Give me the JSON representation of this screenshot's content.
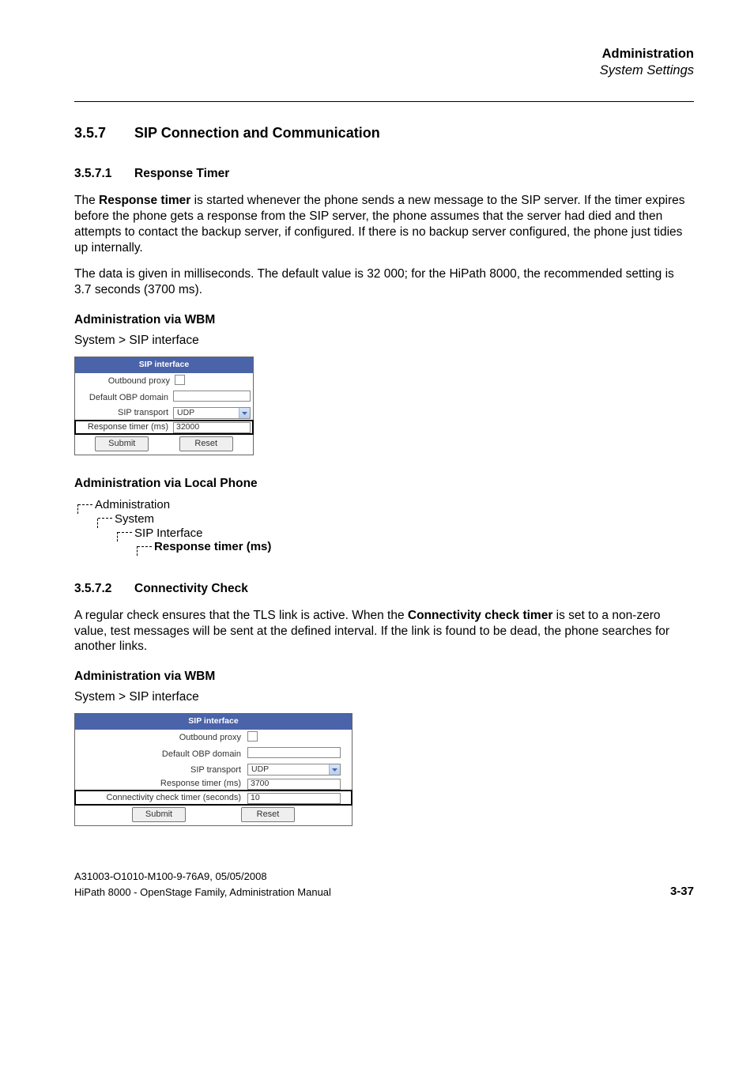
{
  "header": {
    "title_bold": "Administration",
    "subtitle_italic": "System Settings"
  },
  "sections": {
    "s357": {
      "num": "3.5.7",
      "title": "SIP Connection and Communication"
    },
    "s3571": {
      "num": "3.5.7.1",
      "title": "Response Timer"
    },
    "s3572": {
      "num": "3.5.7.2",
      "title": "Connectivity Check"
    }
  },
  "paragraphs": {
    "p1": "The Response timer is started whenever the phone sends a new message to the SIP server. If the timer expires before the phone gets a response from the SIP server, the phone assumes that the server had died and then attempts to contact the backup server, if configured. If there is no backup server configured, the phone just tidies up internally.",
    "p1_bold_phrase": "Response timer",
    "p2": "The data is given in milliseconds. The default value is 32 000; for the HiPath 8000, the recommended setting is 3.7 seconds (3700 ms).",
    "p_cc": "A regular check ensures that the TLS link is active. When the Connectivity check timer is set to a non-zero value, test messages will be sent at the defined interval. If the link is found to be dead, the phone searches for another links.",
    "p_cc_bold_phrase": "Connectivity check timer"
  },
  "subheadings": {
    "wbm": "Administration via WBM",
    "local": "Administration via Local Phone"
  },
  "breadcrumb": "System > SIP interface",
  "panel_common": {
    "title": "SIP interface",
    "labels": {
      "outbound_proxy": "Outbound proxy",
      "default_obp": "Default OBP domain",
      "sip_transport": "SIP transport",
      "response_timer": "Response timer (ms)",
      "connectivity_timer": "Connectivity check timer (seconds)"
    },
    "submit": "Submit",
    "reset": "Reset"
  },
  "panel1": {
    "sip_transport_value": "UDP",
    "response_timer_value": "32000"
  },
  "panel2": {
    "sip_transport_value": "UDP",
    "response_timer_value": "3700",
    "connectivity_timer_value": "10"
  },
  "tree": {
    "n1": "Administration",
    "n2": "System",
    "n3": "SIP Interface",
    "n4": "Response timer (ms)"
  },
  "footer": {
    "line1": "A31003-O1010-M100-9-76A9, 05/05/2008",
    "line2": "HiPath 8000 - OpenStage Family, Administration Manual",
    "page": "3-37"
  }
}
